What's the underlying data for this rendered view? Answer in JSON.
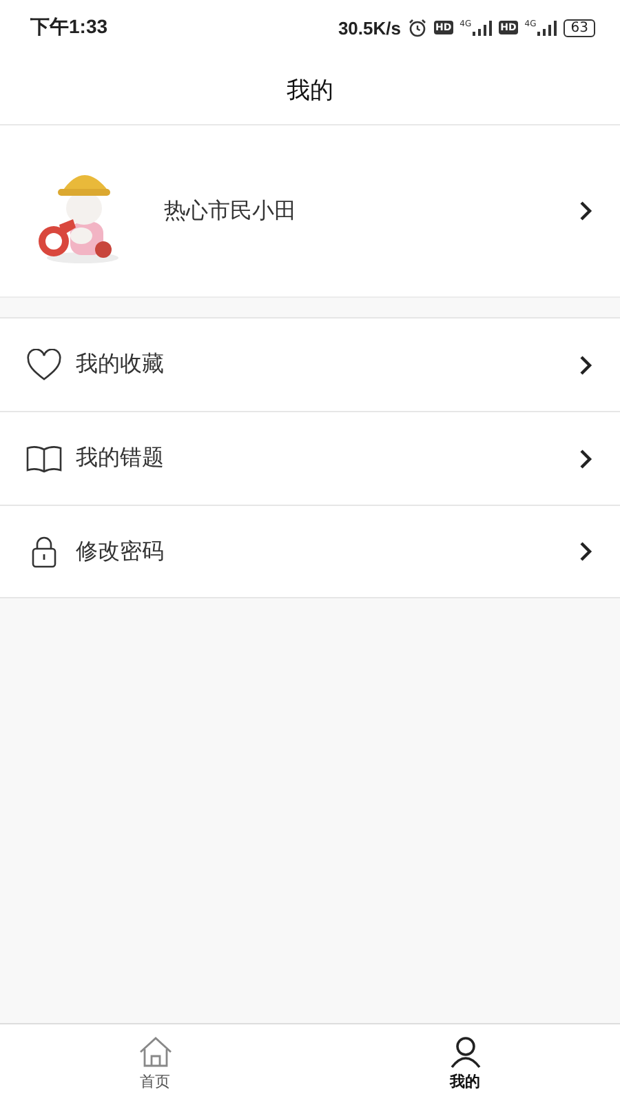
{
  "status_bar": {
    "time": "下午1:33",
    "speed": "30.5K/s",
    "sims": [
      {
        "hd": "HD",
        "net": "4G"
      },
      {
        "hd": "HD",
        "net": "4G"
      }
    ],
    "battery": "63"
  },
  "header": {
    "title": "我的"
  },
  "profile": {
    "name": "热心市民小田"
  },
  "menu": [
    {
      "kind": "heart",
      "label": "我的收藏"
    },
    {
      "kind": "book",
      "label": "我的错题"
    },
    {
      "kind": "lock",
      "label": "修改密码"
    }
  ],
  "tabs": [
    {
      "kind": "home",
      "label": "首页",
      "selected": false
    },
    {
      "kind": "person",
      "label": "我的",
      "selected": true
    }
  ]
}
